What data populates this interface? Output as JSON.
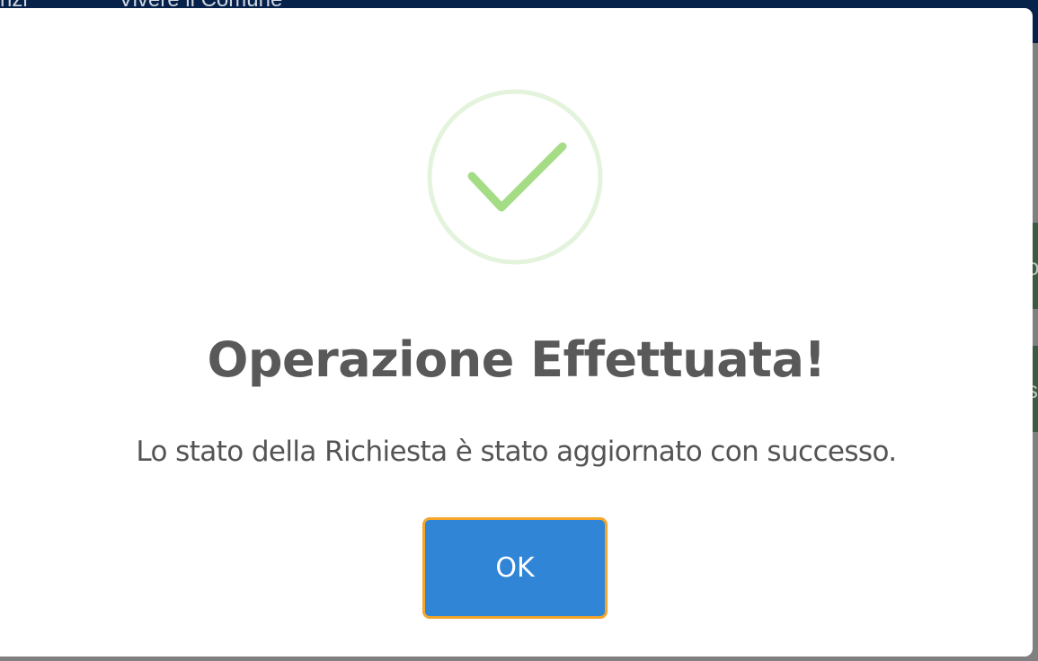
{
  "background": {
    "header_text_left": "nzi",
    "header_text_mid": "Vivere il Comune",
    "tile_1_char": "o",
    "tile_2_char": "s"
  },
  "dialog": {
    "icon": "success-checkmark-icon",
    "title": "Operazione Effettuata!",
    "message": "Lo stato della Richiesta è stato aggiornato con successo.",
    "ok_label": "OK"
  },
  "colors": {
    "confirm_button": "#3085d6",
    "focus_ring": "#f4a52a",
    "success_ring": "#e3f3dc",
    "success_check": "#a5dc86",
    "header": "#06214a"
  }
}
